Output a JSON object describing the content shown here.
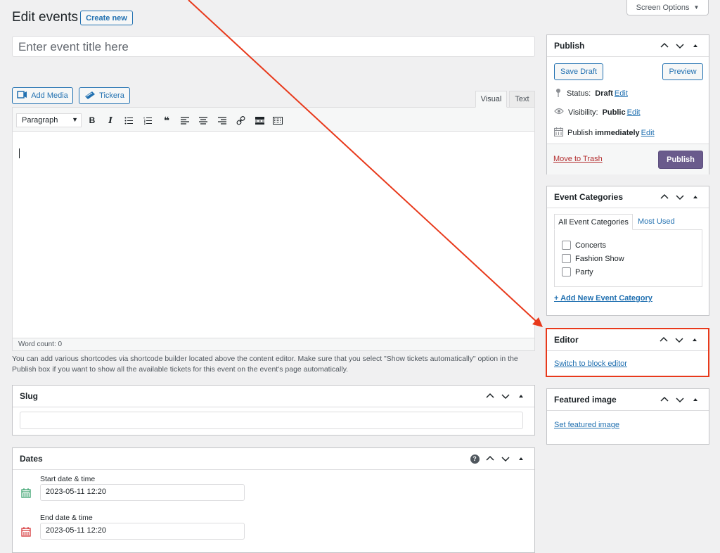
{
  "header": {
    "screen_options": "Screen Options",
    "title": "Edit events",
    "create_new": "Create new"
  },
  "title_field": {
    "placeholder": "Enter event title here"
  },
  "media_buttons": {
    "add_media": "Add Media",
    "tickera": "Tickera"
  },
  "editor_tabs": {
    "visual": "Visual",
    "text": "Text"
  },
  "toolbar": {
    "format": "Paragraph",
    "icons": [
      "bold-icon",
      "italic-icon",
      "bullet-list-icon",
      "numbered-list-icon",
      "blockquote-icon",
      "align-left-icon",
      "align-center-icon",
      "align-right-icon",
      "link-icon",
      "read-more-icon",
      "toolbar-toggle-icon"
    ]
  },
  "word_count": "Word count: 0",
  "help_text": "You can add various shortcodes via shortcode builder located above the content editor. Make sure that you select \"Show tickets automatically\" option in the Publish box if you want to show all the available tickets for this event on the event's page automatically.",
  "slug_box": {
    "title": "Slug"
  },
  "dates_box": {
    "title": "Dates",
    "start_label": "Start date & time",
    "start_value": "2023-05-11 12:20",
    "end_label": "End date & time",
    "end_value": "2023-05-11 12:20"
  },
  "publish_box": {
    "title": "Publish",
    "save_draft": "Save Draft",
    "preview": "Preview",
    "status_label": "Status:",
    "status_value": "Draft",
    "visibility_label": "Visibility:",
    "visibility_value": "Public",
    "publish_label": "Publish",
    "publish_value": "immediately",
    "edit": "Edit",
    "move_to_trash": "Move to Trash",
    "publish_button": "Publish"
  },
  "categories_box": {
    "title": "Event Categories",
    "tab_all": "All Event Categories",
    "tab_most_used": "Most Used",
    "items": [
      "Concerts",
      "Fashion Show",
      "Party"
    ],
    "add_new": "+ Add New Event Category"
  },
  "editor_box": {
    "title": "Editor",
    "switch_link": "Switch to block editor"
  },
  "featured_box": {
    "title": "Featured image",
    "set_link": "Set featured image"
  },
  "colors": {
    "accent": "#2271b1",
    "publish_button": "#6a5b8c",
    "annotation": "#e8391b",
    "trash": "#b32d2e"
  }
}
